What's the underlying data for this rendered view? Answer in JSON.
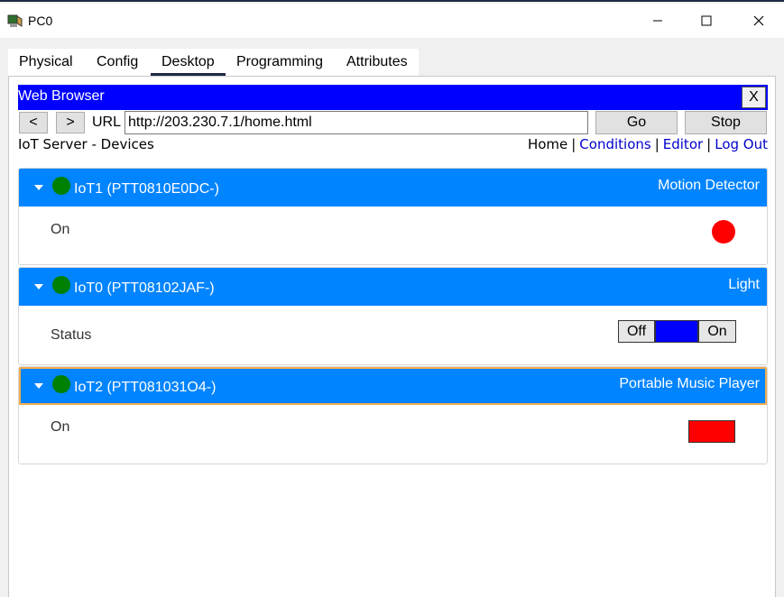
{
  "window": {
    "title": "PC0"
  },
  "tabs": [
    {
      "label": "Physical"
    },
    {
      "label": "Config"
    },
    {
      "label": "Desktop",
      "active": true
    },
    {
      "label": "Programming"
    },
    {
      "label": "Attributes"
    }
  ],
  "browser": {
    "title": "Web Browser",
    "close_label": "X",
    "back_label": "<",
    "forward_label": ">",
    "url_label": "URL",
    "url_value": "http://203.230.7.1/home.html",
    "go_label": "Go",
    "stop_label": "Stop"
  },
  "page": {
    "title": "IoT Server - Devices",
    "links": {
      "home": "Home",
      "conditions": "Conditions",
      "editor": "Editor",
      "logout": "Log Out",
      "separator": "|"
    }
  },
  "devices": [
    {
      "name": "IoT1 (PTT0810E0DC-)",
      "type": "Motion Detector",
      "prop_label": "On",
      "status_color": "#008000",
      "indicator_color": "#ff0000"
    },
    {
      "name": "IoT0 (PTT08102JAF-)",
      "type": "Light",
      "prop_label": "Status",
      "status_color": "#008000",
      "toggle": {
        "off_label": "Off",
        "on_label": "On"
      }
    },
    {
      "name": "IoT2 (PTT081031O4-)",
      "type": "Portable Music Player",
      "prop_label": "On",
      "status_color": "#008000",
      "indicator_color": "#ff0000",
      "selected": true
    }
  ],
  "colors": {
    "browser_title_bar": "#0000ff",
    "device_header": "#0084ff",
    "link": "#0000cc"
  }
}
